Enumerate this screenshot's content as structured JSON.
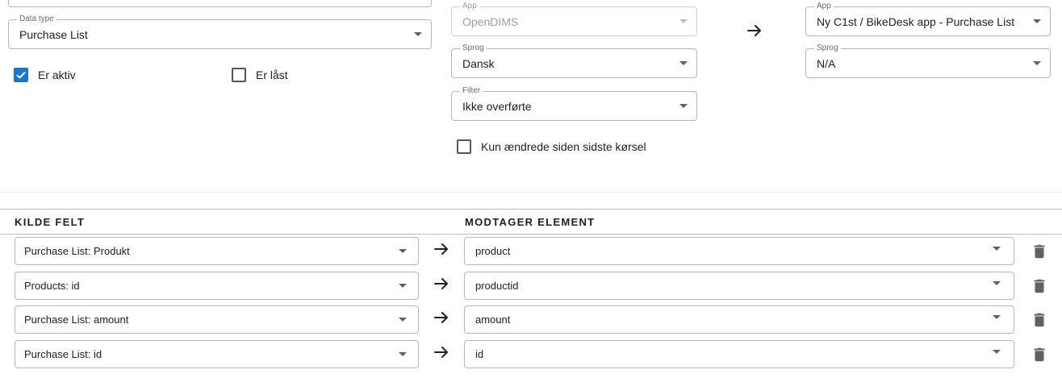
{
  "source": {
    "data_type": {
      "label": "Data type",
      "value": "Purchase List"
    },
    "er_aktiv": {
      "label": "Er aktiv",
      "checked": true
    },
    "er_last": {
      "label": "Er låst",
      "checked": false
    }
  },
  "middle": {
    "app": {
      "label": "App",
      "value": "OpenDIMS",
      "disabled": true
    },
    "sprog": {
      "label": "Sprog",
      "value": "Dansk"
    },
    "filter": {
      "label": "Filter",
      "value": "Ikke overførte"
    },
    "kun_aendrede": {
      "label": "Kun ændrede siden sidste kørsel",
      "checked": false
    }
  },
  "target": {
    "app": {
      "label": "App",
      "value": "Ny C1st / BikeDesk app - Purchase List"
    },
    "sprog": {
      "label": "Sprog",
      "value": "N/A"
    }
  },
  "mapping": {
    "col_source": "KILDE FELT",
    "col_target": "MODTAGER ELEMENT",
    "rows": [
      {
        "source": "Purchase List: Produkt",
        "target": "product"
      },
      {
        "source": "Products: id",
        "target": "productid"
      },
      {
        "source": "Purchase List: amount",
        "target": "amount"
      },
      {
        "source": "Purchase List: id",
        "target": "id"
      }
    ]
  },
  "icons": {
    "arrow": "arrow-right-icon",
    "delete": "trash-icon",
    "dropdown": "chevron-down-icon",
    "check": "check-icon"
  },
  "colors": {
    "accent": "#1976d2",
    "border": "#b8b8b8",
    "text": "#212121",
    "label": "#6b6b6b",
    "disabled_text": "#9e9e9e"
  }
}
